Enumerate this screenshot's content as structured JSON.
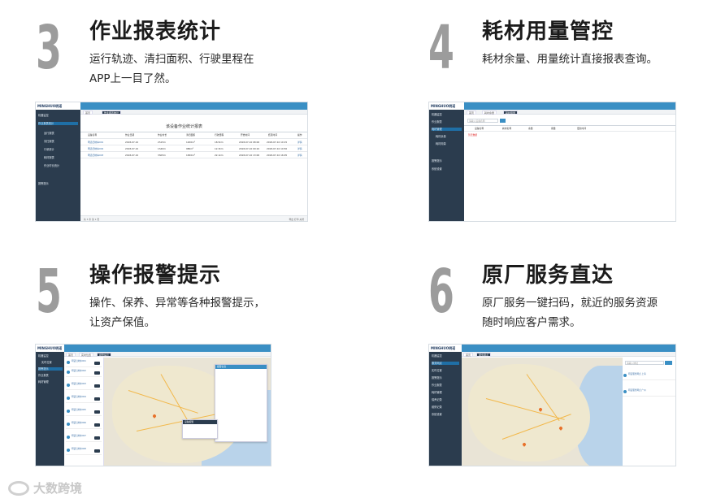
{
  "features": [
    {
      "number": "3",
      "title": "作业报表统计",
      "desc": [
        "运行轨迹、清扫面积、行驶里程在",
        "APP上一目了然。"
      ],
      "screenshot": {
        "brand": "MINGHUO明诺",
        "sidebar": [
          "机器监控",
          "作业报表统计",
          "运行报表",
          "清扫报表",
          "行驶统计",
          "耗材报表",
          "作业时长统计",
          "报警提示"
        ],
        "tabs": [
          "首页",
          "作业报表统计"
        ],
        "table_title": "该设备作业统计报表",
        "columns": [
          "设备名称",
          "作业日期",
          "作业时长",
          "清扫面积",
          "行驶里程",
          "开始时间",
          "结束时间",
          "操作"
        ],
        "rows": [
          [
            "明诺扫地车001",
            "2018-07-10",
            "2h15m",
            "1200m²",
            "18.5km",
            "2018-07-10 08:00",
            "2018-07-10 10:15",
            "详情"
          ],
          [
            "明诺扫地车002",
            "2018-07-10",
            "1h40m",
            "980m²",
            "12.3km",
            "2018-07-10 09:10",
            "2018-07-10 10:50",
            "详情"
          ],
          [
            "明诺扫地车003",
            "2018-07-10",
            "3h05m",
            "1650m²",
            "22.1km",
            "2018-07-10 13:00",
            "2018-07-10 16:05",
            "详情"
          ]
        ],
        "pager": "共 3 条 第 1 页",
        "export": "导出 打印 关闭"
      }
    },
    {
      "number": "4",
      "title": "耗材用量管控",
      "desc": [
        "耗材余量、用量统计直接报表查询。"
      ],
      "screenshot": {
        "brand": "MINGHUO明诺",
        "sidebar": [
          "机器监控",
          "作业报表",
          "耗材管理",
          "耗材余量",
          "耗材用量",
          "报警提示",
          "系统设置"
        ],
        "tabs": [
          "首页",
          "耗材余量",
          "耗材用量"
        ],
        "search_placeholder": "请输入设备名称",
        "columns": [
          "设备名称",
          "耗材名称",
          "余量",
          "用量",
          "更新时间"
        ],
        "notice": "暂无数据"
      }
    },
    {
      "number": "5",
      "title": "操作报警提示",
      "desc": [
        "操作、保养、异常等各种报警提示，",
        "让资产保值。"
      ],
      "screenshot": {
        "brand": "MINGHUO明诺",
        "sidebar": [
          "机器监控",
          "实时位置",
          "报警提示",
          "作业报表",
          "耗材管理"
        ],
        "tabs": [
          "首页",
          "实时位置",
          "报警提示"
        ],
        "list": [
          "明诺扫地车001",
          "明诺扫地车002",
          "明诺扫地车003",
          "明诺扫地车004",
          "明诺扫地车005",
          "明诺扫地车006",
          "明诺扫地车007",
          "明诺扫地车008"
        ],
        "popup_title": "报警信息",
        "vehicle_popup": "设备报警"
      }
    },
    {
      "number": "6",
      "title": "原厂服务直达",
      "desc": [
        "原厂服务一键扫码，就近的服务资源",
        "随时响应客户需求。"
      ],
      "screenshot": {
        "brand": "MINGHUO明诺",
        "sidebar": [
          "机器监控",
          "服务网点",
          "实时位置",
          "报警提示",
          "作业报表",
          "耗材管理",
          "保养记录",
          "维修记录",
          "系统设置"
        ],
        "tabs": [
          "首页",
          "服务网点"
        ],
        "search_placeholder": "请输入地址",
        "results": [
          "明诺服务网点 上海",
          "明诺服务网点 广州"
        ]
      }
    }
  ],
  "watermark": "大数跨境"
}
